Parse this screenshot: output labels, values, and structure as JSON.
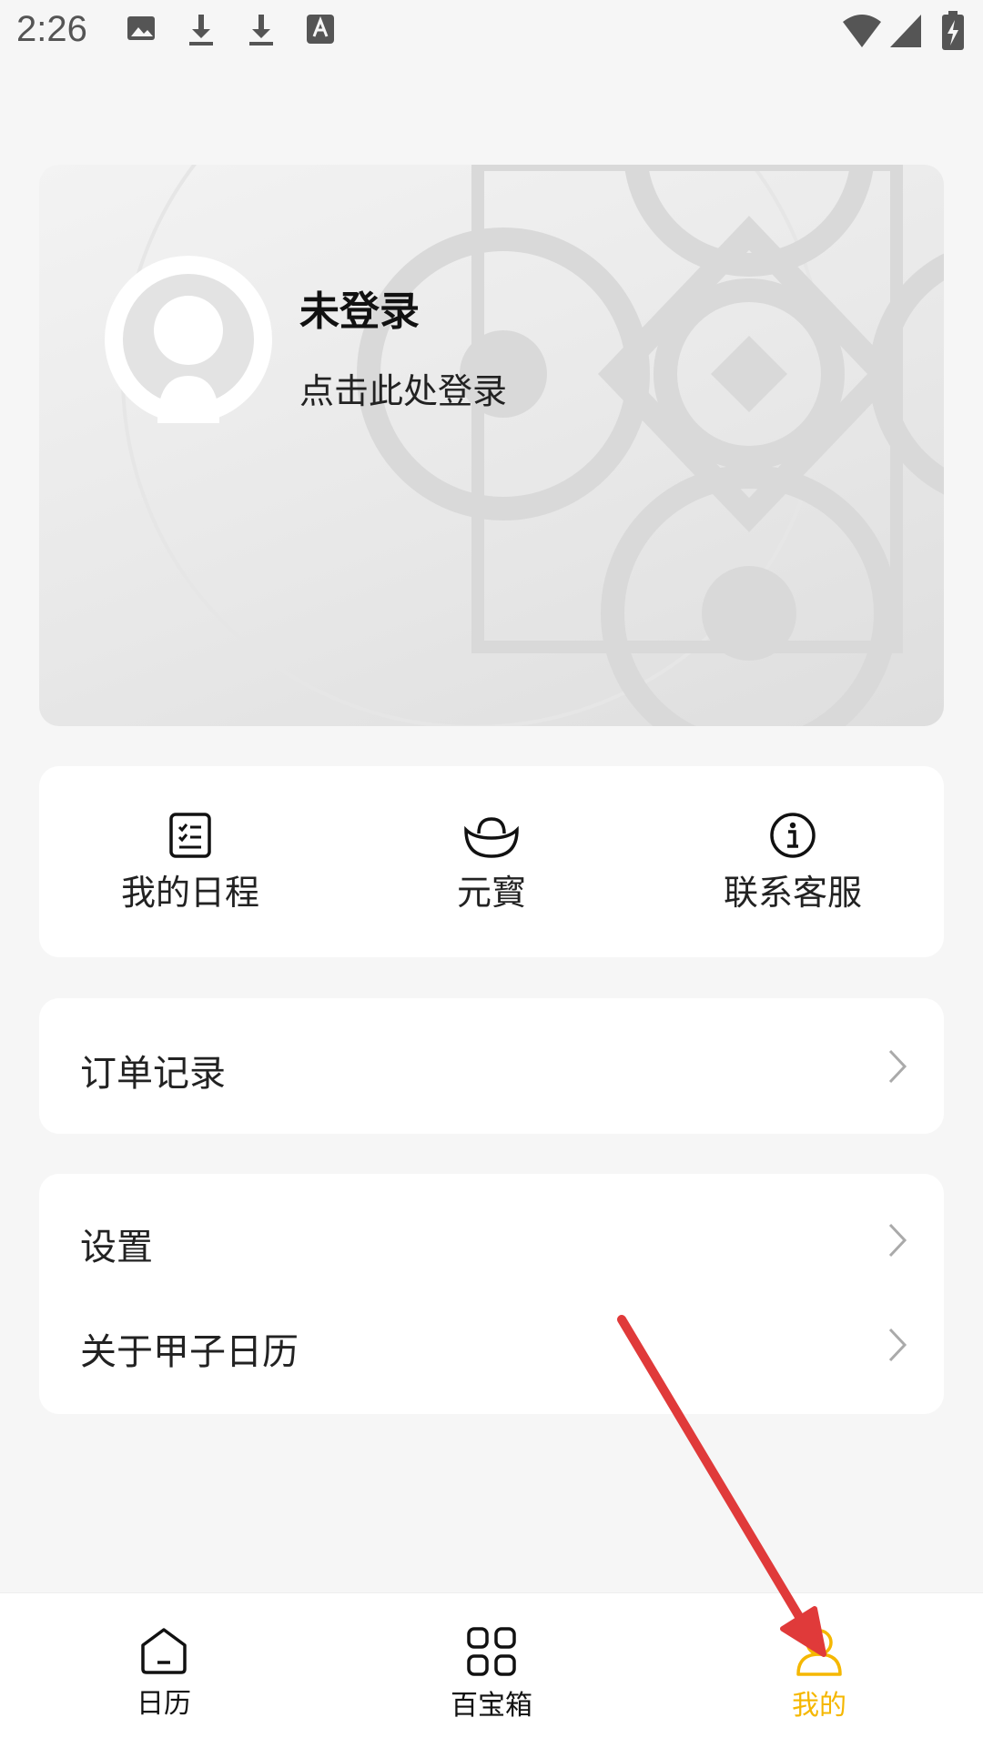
{
  "status_bar": {
    "time": "2:26",
    "icons": [
      "image-icon",
      "download-icon",
      "download-icon",
      "text-a-icon",
      "wifi-icon",
      "signal-icon",
      "battery-charging-icon"
    ]
  },
  "profile_card": {
    "title": "未登录",
    "subtitle": "点击此处登录"
  },
  "quick_actions": [
    {
      "label": "我的日程",
      "icon": "schedule-icon"
    },
    {
      "label": "元寳",
      "icon": "ingot-icon"
    },
    {
      "label": "联系客服",
      "icon": "info-icon"
    }
  ],
  "menu_group_1": [
    {
      "label": "订单记录"
    }
  ],
  "menu_group_2": [
    {
      "label": "设置"
    },
    {
      "label": "关于甲子日历"
    }
  ],
  "tab_bar": {
    "tabs": [
      {
        "label": "日历",
        "icon": "home-icon"
      },
      {
        "label": "百宝箱",
        "icon": "grid-icon"
      },
      {
        "label": "我的",
        "icon": "user-icon"
      }
    ],
    "active_color": "#f5b700"
  },
  "annotation": {
    "color": "#e03a3a"
  }
}
